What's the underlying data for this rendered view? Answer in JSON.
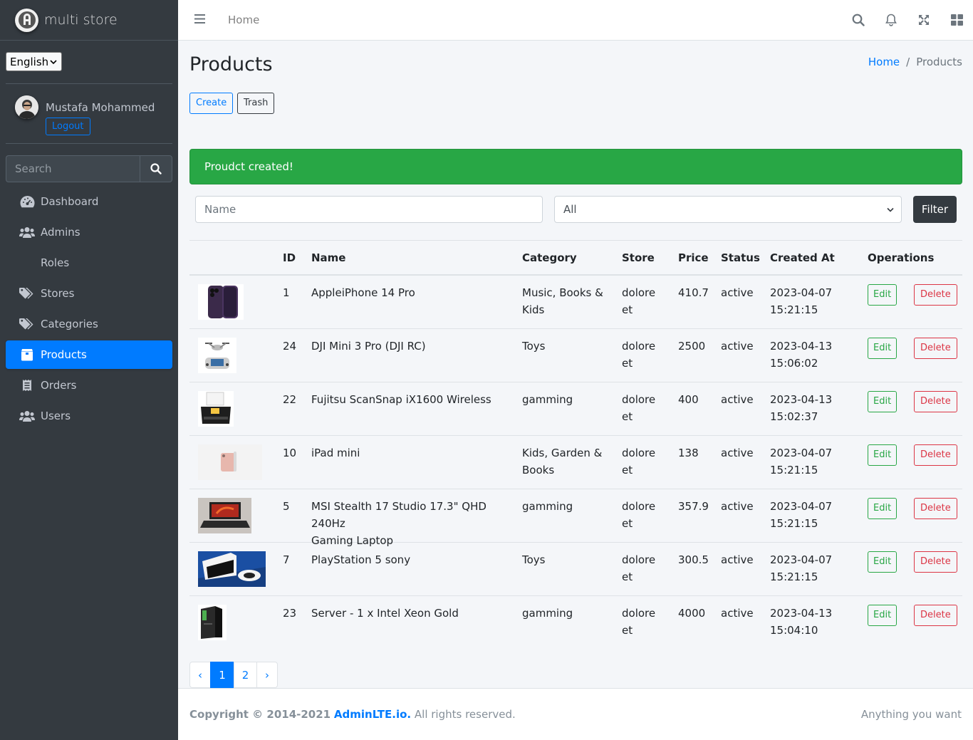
{
  "brand": {
    "name": "multi store"
  },
  "language": {
    "selected": "English"
  },
  "user": {
    "name": "Mustafa Mohammed",
    "logout_label": "Logout"
  },
  "sidebar_search": {
    "placeholder": "Search"
  },
  "nav": [
    {
      "label": "Dashboard",
      "icon": "dashboard-icon"
    },
    {
      "label": "Admins",
      "icon": "users-icon"
    },
    {
      "label": "Roles",
      "icon": ""
    },
    {
      "label": "Stores",
      "icon": "tags-icon"
    },
    {
      "label": "Categories",
      "icon": "tags-icon"
    },
    {
      "label": "Products",
      "icon": "box-icon",
      "active": true
    },
    {
      "label": "Orders",
      "icon": "receipt-icon"
    },
    {
      "label": "Users",
      "icon": "users-icon"
    }
  ],
  "topbar": {
    "home": "Home"
  },
  "page": {
    "title": "Products",
    "breadcrumb": {
      "home": "Home",
      "current": "Products"
    },
    "create_label": "Create",
    "trash_label": "Trash",
    "alert": "Proudct created!"
  },
  "filter": {
    "name_placeholder": "Name",
    "status_selected": "All",
    "button": "Filter"
  },
  "table": {
    "headers": {
      "id": "ID",
      "name": "Name",
      "category": "Category",
      "store": "Store",
      "price": "Price",
      "status": "Status",
      "created": "Created At",
      "operations": "Operations"
    },
    "edit_label": "Edit",
    "delete_label": "Delete",
    "rows": [
      {
        "id": "1",
        "name1": "AppleiPhone 14 Pro",
        "name2": "",
        "cat1": "Music, Books &",
        "cat2": "Kids",
        "store1": "dolore",
        "store2": "et",
        "price": "410.7",
        "status": "active",
        "date": "2023-04-07",
        "time": "15:21:15",
        "img": "iphone"
      },
      {
        "id": "24",
        "name1": "DJI Mini 3 Pro (DJI RC)",
        "name2": "",
        "cat1": "Toys",
        "cat2": "",
        "store1": "dolore",
        "store2": "et",
        "price": "2500",
        "status": "active",
        "date": "2023-04-13",
        "time": "15:06:02",
        "img": "drone"
      },
      {
        "id": "22",
        "name1": "Fujitsu ScanSnap iX1600 Wireless",
        "name2": "",
        "cat1": "gamming",
        "cat2": "",
        "store1": "dolore",
        "store2": "et",
        "price": "400",
        "status": "active",
        "date": "2023-04-13",
        "time": "15:02:37",
        "img": "scanner"
      },
      {
        "id": "10",
        "name1": "iPad mini",
        "name2": "",
        "cat1": "Kids, Garden &",
        "cat2": "Books",
        "store1": "dolore",
        "store2": "et",
        "price": "138",
        "status": "active",
        "date": "2023-04-07",
        "time": "15:21:15",
        "img": "ipad"
      },
      {
        "id": "5",
        "name1": "MSI Stealth 17 Studio 17.3\" QHD 240Hz",
        "name2": "Gaming Laptop",
        "cat1": "gamming",
        "cat2": "",
        "store1": "dolore",
        "store2": "et",
        "price": "357.9",
        "status": "active",
        "date": "2023-04-07",
        "time": "15:21:15",
        "img": "laptop"
      },
      {
        "id": "7",
        "name1": "PlayStation 5 sony",
        "name2": "",
        "cat1": "Toys",
        "cat2": "",
        "store1": "dolore",
        "store2": "et",
        "price": "300.5",
        "status": "active",
        "date": "2023-04-07",
        "time": "15:21:15",
        "img": "ps5"
      },
      {
        "id": "23",
        "name1": "Server - 1 x Intel Xeon Gold",
        "name2": "",
        "cat1": "gamming",
        "cat2": "",
        "store1": "dolore",
        "store2": "et",
        "price": "4000",
        "status": "active",
        "date": "2023-04-13",
        "time": "15:04:10",
        "img": "server"
      }
    ]
  },
  "pagination": {
    "prev": "‹",
    "pages": [
      "1",
      "2"
    ],
    "next": "›",
    "active": "1"
  },
  "footer": {
    "copyright": "Copyright © 2014-2021",
    "link": "AdminLTE.io.",
    "rights": "All rights reserved.",
    "right_text": "Anything you want"
  },
  "colors": {
    "primary": "#007bff",
    "success": "#28a745",
    "danger": "#dc3545",
    "sidebar": "#343a40"
  }
}
